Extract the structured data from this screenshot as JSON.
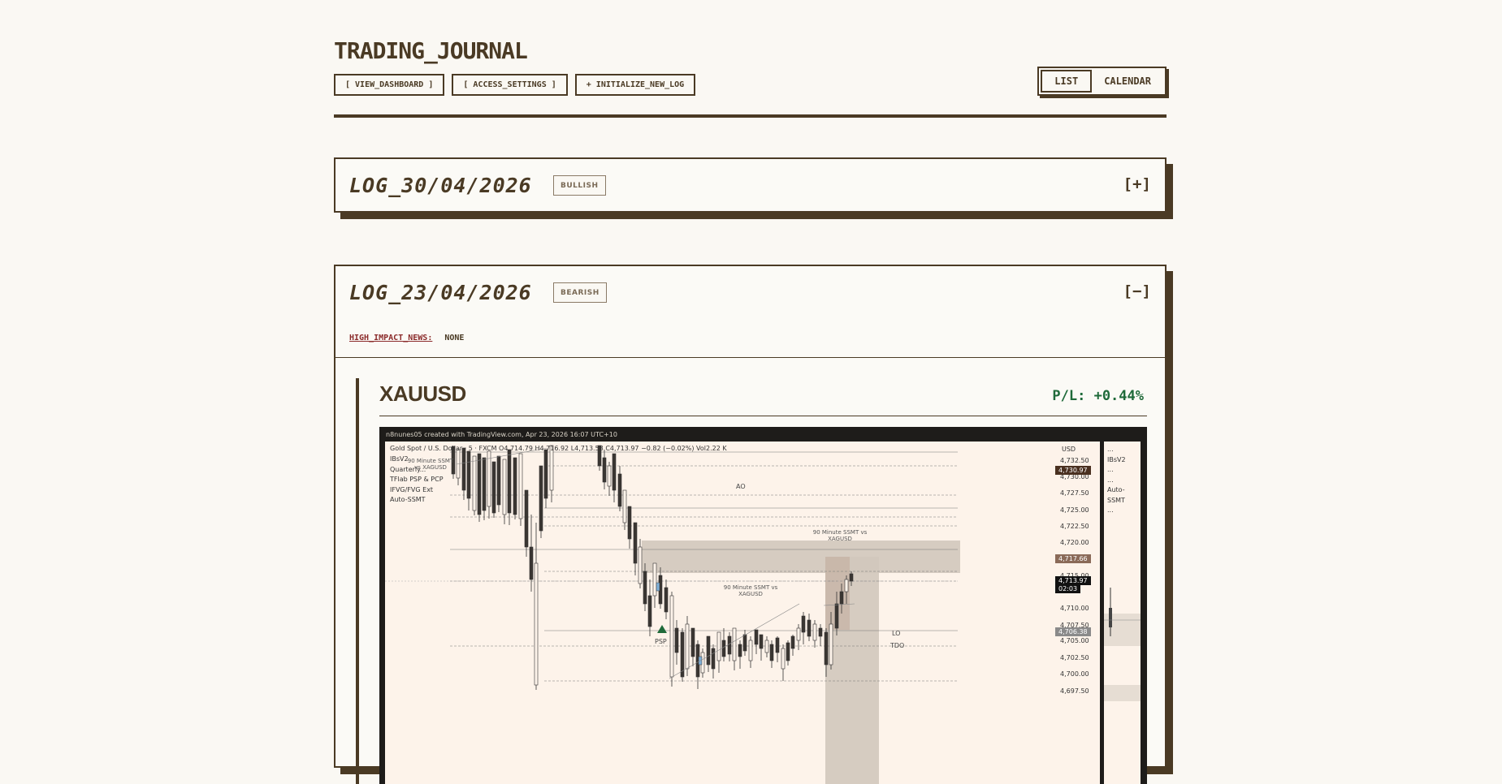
{
  "header": {
    "title": "TRADING_JOURNAL",
    "nav": [
      {
        "label": "[ VIEW_DASHBOARD ]"
      },
      {
        "label": "[ ACCESS_SETTINGS ]"
      },
      {
        "label": "+ INITIALIZE_NEW_LOG"
      }
    ],
    "views": {
      "list": "LIST",
      "calendar": "CALENDAR",
      "active": "LIST"
    }
  },
  "logs": [
    {
      "title": "LOG_30/04/2026",
      "bias": "BULLISH",
      "toggle": "[+]",
      "expanded": false
    },
    {
      "title": "LOG_23/04/2026",
      "bias": "BEARISH",
      "toggle": "[−]",
      "expanded": true,
      "news_label": "HIGH_IMPACT_NEWS:",
      "news_value": "NONE",
      "trade": {
        "ticker": "XAUUSD",
        "pl": "P/L: +0.44%",
        "pl_color": "#1f6a3a",
        "screenshot": {
          "caption": "n8nunes05 created with TradingView.com, Apr 23, 2026 16:07 UTC+10",
          "ohlc": "Gold Spot / U.S. Dollar · 5 · FXCM  O4,714.79  H4,716.92  L4,713.58  C4,713.97  −0.82 (−0.02%)  Vol2.22 K",
          "indicators": [
            "IBsV2",
            "Quarterly...",
            "TFlab PSP & PCP",
            "IFVG/FVG Ext",
            "Auto-SSMT"
          ],
          "side_indicators": [
            "...",
            "IBsV2",
            "...",
            "...",
            "Auto-SSMT",
            "..."
          ],
          "currency": "USD",
          "price_ticks": [
            "4,732.50",
            "4,730.00",
            "4,727.50",
            "4,725.00",
            "4,722.50",
            "4,720.00",
            "4,715.00",
            "4,710.00",
            "4,707.50",
            "4,705.00",
            "4,702.50",
            "4,700.00",
            "4,697.50"
          ],
          "price_tags": [
            {
              "label": "4,730.97",
              "color": "#4a3020"
            },
            {
              "label": "4,717.66",
              "color": "#8a6a58"
            },
            {
              "label": "4,713.97",
              "color": "#111111"
            },
            {
              "label": "02:03",
              "color": "#111111"
            },
            {
              "label": "4,706.38",
              "color": "#8a8a8a"
            }
          ],
          "annotations": {
            "ao": "AO",
            "ssmt_top": "90 Minute SSMT vs XAGUSD",
            "ssmt_mid": "90 Minute SSMT vs XAGUSD",
            "ssmt_left": "90 Minute SSMT vs XAGUSD",
            "psp": "PSP",
            "lo": "LO",
            "tdo": "TDO"
          }
        }
      }
    }
  ]
}
